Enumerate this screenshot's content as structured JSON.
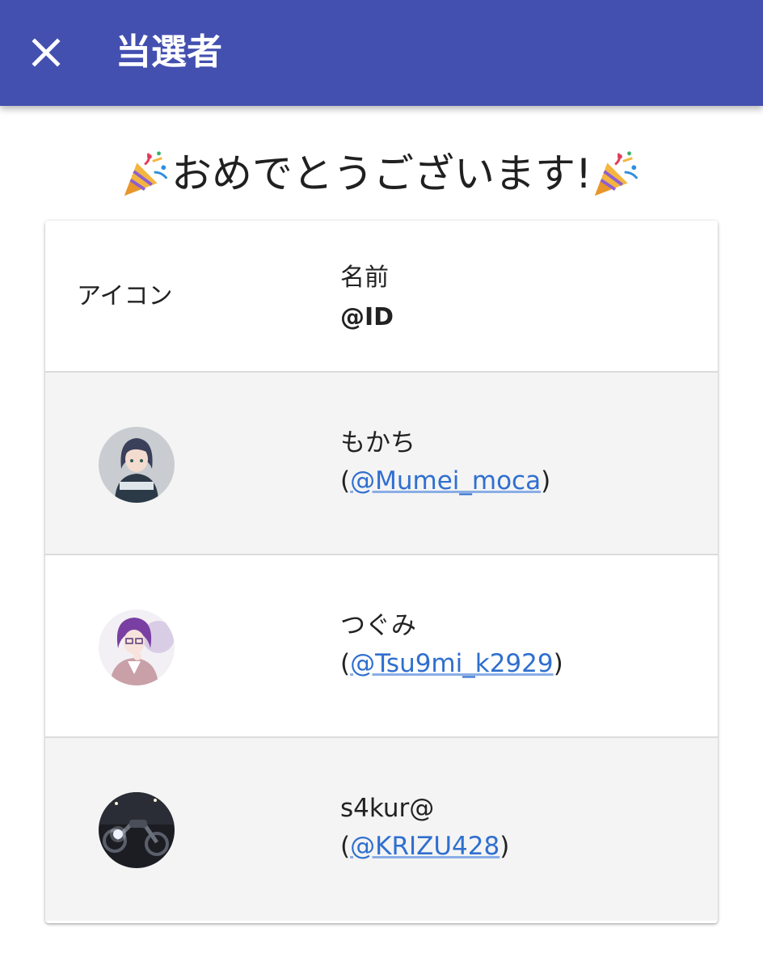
{
  "appbar": {
    "close_icon": "close-icon",
    "title": "当選者",
    "color": "#4350b0"
  },
  "congrats": {
    "text": "おめでとうございます!",
    "icon": "party-popper-icon"
  },
  "table": {
    "headers": {
      "icon": "アイコン",
      "name": "名前",
      "id": "@ID"
    },
    "rows": [
      {
        "name": "もかち",
        "handle": "@Mumei_moca",
        "avatar": "avatar-girl-hoodie"
      },
      {
        "name": "つぐみ",
        "handle": "@Tsu9mi_k2929",
        "avatar": "avatar-girl-glasses"
      },
      {
        "name": "s4kur@",
        "handle": "@KRIZU428",
        "avatar": "avatar-motorcycle-night"
      }
    ]
  },
  "colors": {
    "link": "#2f6fcf",
    "row_shade": "#f4f4f4"
  }
}
